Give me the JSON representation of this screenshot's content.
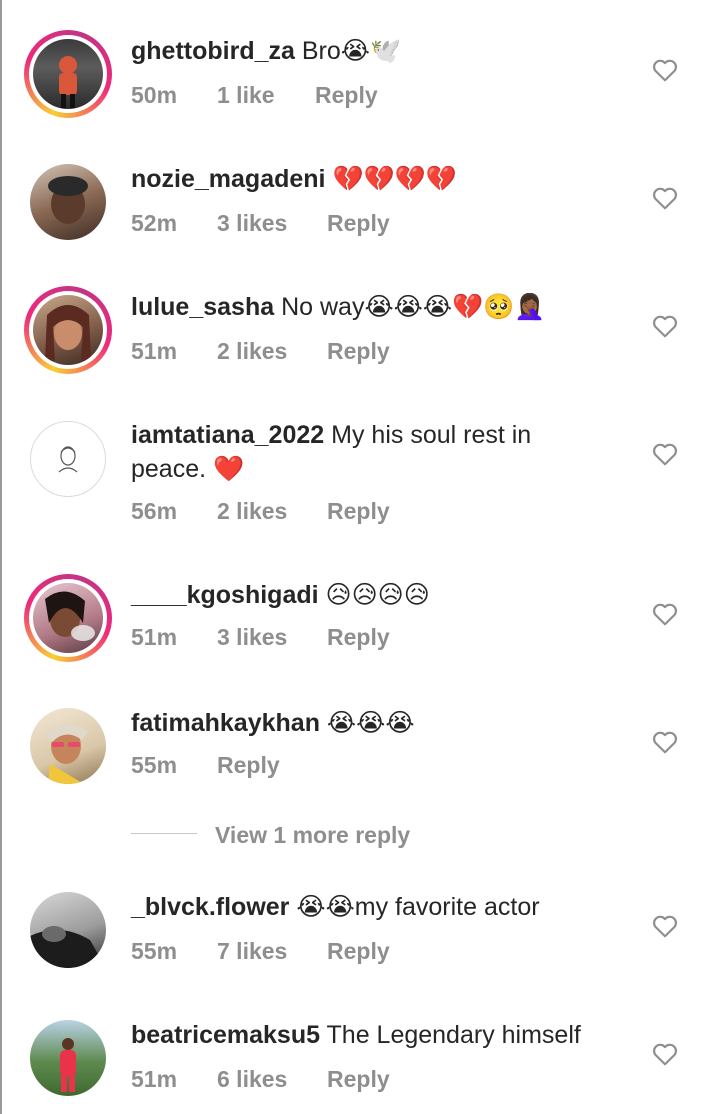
{
  "comments": [
    {
      "username": "ghettobird_za",
      "text": "Bro😭🕊️",
      "time": "50m",
      "likes": "1 like",
      "reply": "Reply"
    },
    {
      "username": "nozie_magadeni",
      "text": "💔💔💔💔",
      "time": "52m",
      "likes": "3 likes",
      "reply": "Reply"
    },
    {
      "username": "lulue_sasha",
      "text": "No way😭😭😭💔🥺🤦🏾‍♀️",
      "time": "51m",
      "likes": "2 likes",
      "reply": "Reply"
    },
    {
      "username": "iamtatiana_2022",
      "text": "My his soul rest in peace. ❤️",
      "time": "56m",
      "likes": "2 likes",
      "reply": "Reply"
    },
    {
      "username": "____kgoshigadi",
      "text": "😥😥😥😥",
      "time": "51m",
      "likes": "3 likes",
      "reply": "Reply"
    },
    {
      "username": "fatimahkaykhan",
      "text": "😭😭😭",
      "time": "55m",
      "likes": "",
      "reply": "Reply"
    },
    {
      "username": "_blvck.flower",
      "text": "😭😭my favorite actor",
      "time": "55m",
      "likes": "7 likes",
      "reply": "Reply"
    },
    {
      "username": "beatricemaksu5",
      "text": "The Legendary himself",
      "time": "51m",
      "likes": "6 likes",
      "reply": "Reply"
    }
  ],
  "view_more": "View 1 more reply",
  "icons": {
    "like": "heart-outline-icon",
    "default_avatar": "default-avatar-icon"
  },
  "colors": {
    "meta_text": "#8e8e8e",
    "story_ring_start": "#f9ce34",
    "story_ring_end": "#c13584"
  }
}
